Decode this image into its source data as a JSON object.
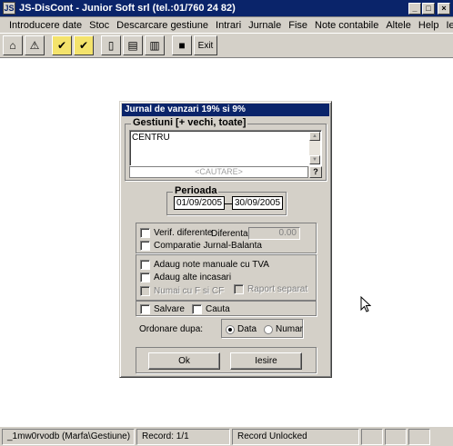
{
  "window": {
    "title": "JS-DisCont - Junior Soft srl (tel.:01/760 24 82)",
    "app_icon": "JS",
    "controls": [
      "_",
      "□",
      "×"
    ]
  },
  "menu": [
    "Introducere date",
    "Stoc",
    "Descarcare gestiune",
    "Intrari",
    "Jurnale",
    "Fise",
    "Note contabile",
    "Altele",
    "Help",
    "Iesire"
  ],
  "toolbar": {
    "exit_label": "Exit",
    "icons": [
      "home-icon",
      "warning-icon",
      "checked-doc-icon",
      "checked-doc-icon",
      "book-icon",
      "chart-a-icon",
      "chart-b-icon",
      "book-red-icon"
    ]
  },
  "dialog": {
    "title": "Jurnal de vanzari 19% si 9%",
    "gestiuni": {
      "label": "Gestiuni [+ vechi, toate]",
      "items": [
        "CENTRU"
      ],
      "search_placeholder": "<CAUTARE>",
      "help_label": "?"
    },
    "perioada": {
      "label": "Perioada",
      "from": "01/09/2005",
      "to": "30/09/2005"
    },
    "checks": {
      "verif_diferente": "Verif. diferente",
      "diferenta_label": "Diferenta:",
      "diferenta_value": "0.00",
      "comparatie": "Comparatie Jurnal-Balanta",
      "adaug_note": "Adaug note manuale cu TVA",
      "adaug_incasari": "Adaug alte incasari",
      "numai_cu_f": "Numai cu F si CF",
      "raport_separat": "Raport separat",
      "salvare": "Salvare",
      "cauta": "Cauta"
    },
    "ordonare": {
      "label": "Ordonare dupa:",
      "options": [
        "Data",
        "Numar"
      ],
      "selected": "Data"
    },
    "buttons": {
      "ok": "Ok",
      "iesire": "Iesire"
    }
  },
  "status": {
    "panel1": "_1mw0rvodb (Marfa\\Gestiune)",
    "panel2": "Record: 1/1",
    "panel3": "Record Unlocked"
  }
}
